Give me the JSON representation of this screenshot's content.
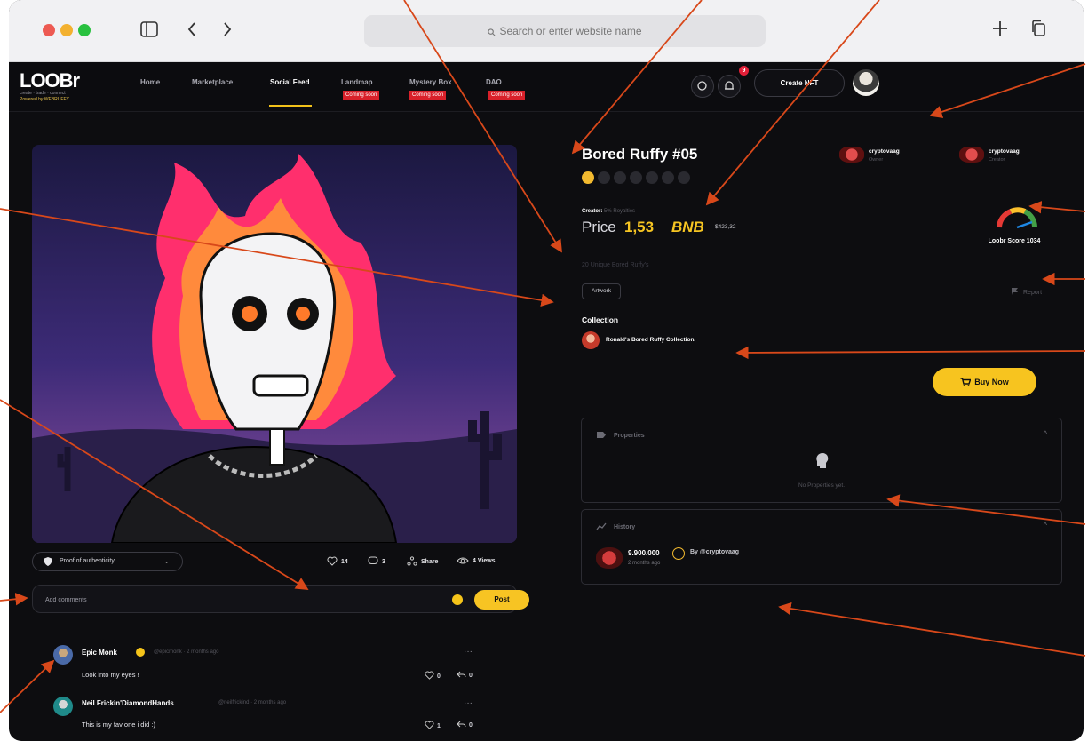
{
  "browser": {
    "url_placeholder": "Search or enter website name"
  },
  "site": {
    "logo": "LOOBr",
    "logo_tagline": "create · trade · connect",
    "logo_powered": "Powered by WEBRUFFY",
    "nav": [
      {
        "label": "Home"
      },
      {
        "label": "Marketplace"
      },
      {
        "label": "Social Feed"
      },
      {
        "label": "Landmap",
        "badge": "Coming soon"
      },
      {
        "label": "Mystery Box",
        "badge": "Coming soon"
      },
      {
        "label": "DAO",
        "badge": "Coming soon"
      }
    ],
    "notification_count": "9",
    "create_label": "Create NFT"
  },
  "stats": {
    "proof_label": "Proof of authenticity",
    "likes": "14",
    "comments": "3",
    "share_label": "Share",
    "views": "4 Views"
  },
  "comment_form": {
    "placeholder": "Add comments",
    "post_label": "Post"
  },
  "comments": [
    {
      "name": "Epic Monk",
      "handle": "@epicmonk · 2 months ago",
      "text": "Look into my eyes !",
      "likes": "0",
      "replies": "0"
    },
    {
      "name": "Neil Frickin'DiamondHands",
      "handle": "@neilfrickind · 2 months ago",
      "text": "This is my fav one i did :)",
      "likes": "1",
      "replies": "0"
    }
  ],
  "nft": {
    "title": "Bored Ruffy #05",
    "owner_name": "cryptovaag",
    "owner_role": "Owner",
    "creator_name": "cryptovaag",
    "creator_role": "Creator",
    "creator_label": "Creator:",
    "royalties": "5% Royalties",
    "price_label": "Price",
    "price_value": "1,53",
    "price_currency": "BNB",
    "price_usd": "$423,32",
    "score_label": "Loobr Score 1034",
    "description": "20 Unique Bored Ruffy's",
    "tag": "Artwork",
    "report_label": "Report",
    "collection_label": "Collection",
    "collection_name": "Ronald's Bored Ruffy Collection.",
    "buy_label": "Buy Now"
  },
  "properties": {
    "title": "Properties",
    "empty_text": "No Properties yet."
  },
  "history": {
    "title": "History",
    "amount": "9.900.000",
    "by": "By @cryptovaag",
    "ago": "2 months ago"
  },
  "colors": {
    "accent": "#f7c423",
    "background": "#0d0d10",
    "annotation_arrow": "#d8481a",
    "coming_soon_badge": "#d9202a"
  }
}
